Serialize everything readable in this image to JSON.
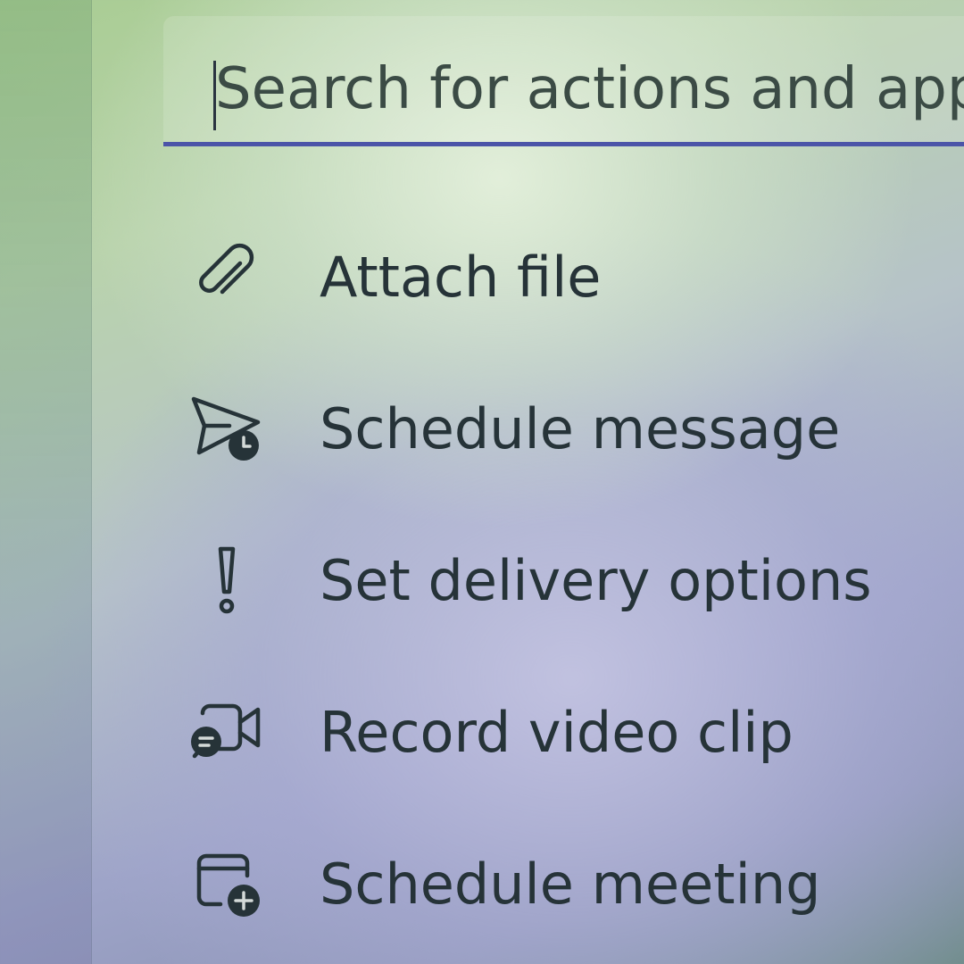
{
  "search": {
    "placeholder": "Search for actions and apps",
    "value": ""
  },
  "menu": {
    "items": [
      {
        "label": "Attach file",
        "icon": "paperclip-icon"
      },
      {
        "label": "Schedule message",
        "icon": "send-clock-icon"
      },
      {
        "label": "Set delivery options",
        "icon": "exclamation-icon"
      },
      {
        "label": "Record video clip",
        "icon": "video-clip-icon"
      },
      {
        "label": "Schedule meeting",
        "icon": "calendar-add-icon"
      }
    ]
  },
  "colors": {
    "accent": "#4b54a8",
    "text": "#263338"
  }
}
